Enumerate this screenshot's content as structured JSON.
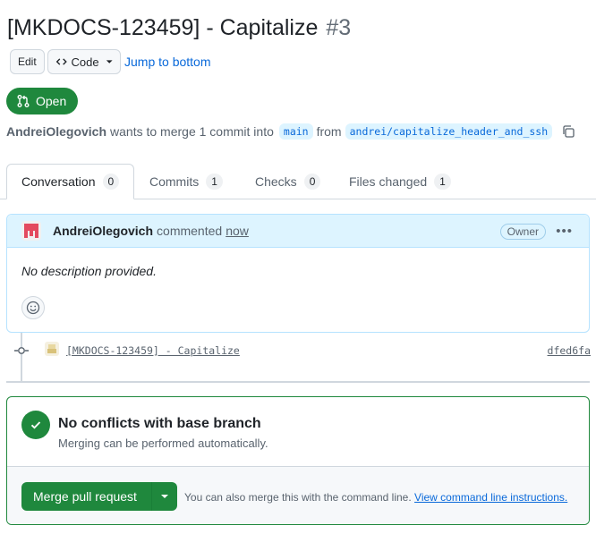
{
  "pr": {
    "title": "[MKDOCS-123459] - Capitalize",
    "number": "#3",
    "state": "Open"
  },
  "toolbar": {
    "edit_label": "Edit",
    "code_label": "Code",
    "jump_label": "Jump to bottom"
  },
  "meta": {
    "author": "AndreiOlegovich",
    "text_merge": "wants to merge 1 commit into",
    "base_branch": "main",
    "text_from": "from",
    "head_branch": "andrei/capitalize_header_and_ssh"
  },
  "tabs": [
    {
      "label": "Conversation",
      "count": "0",
      "active": true
    },
    {
      "label": "Commits",
      "count": "1"
    },
    {
      "label": "Checks",
      "count": "0"
    },
    {
      "label": "Files changed",
      "count": "1"
    }
  ],
  "comment": {
    "author": "AndreiOlegovich",
    "verb": "commented",
    "timestamp": "now",
    "role": "Owner",
    "body": "No description provided."
  },
  "commit": {
    "message": "[MKDOCS-123459] - Capitalize",
    "sha": "dfed6fa"
  },
  "merge": {
    "heading": "No conflicts with base branch",
    "subtext": "Merging can be performed automatically.",
    "button_label": "Merge pull request",
    "alt_text": "You can also merge this with the command line.",
    "alt_link": "View command line instructions."
  },
  "colors": {
    "accent_green": "#1f883d",
    "link_blue": "#0969da",
    "comment_header_bg": "#ddf4ff"
  }
}
